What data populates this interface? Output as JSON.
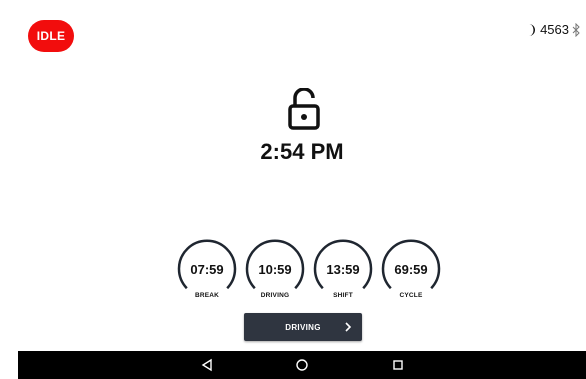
{
  "status": {
    "mode_badge": "IDLE",
    "unit_number": "4563",
    "icons": [
      "moon-icon",
      "bluetooth-icon"
    ]
  },
  "main": {
    "lock_icon": "unlocked-padlock-icon",
    "time": "2:54 PM"
  },
  "gauges": [
    {
      "value": "07:59",
      "label": "BREAK"
    },
    {
      "value": "10:59",
      "label": "DRIVING"
    },
    {
      "value": "13:59",
      "label": "SHIFT"
    },
    {
      "value": "69:59",
      "label": "CYCLE"
    }
  ],
  "action_button": {
    "label": "DRIVING",
    "icon": "chevron-right-icon"
  },
  "navigation_bar": {
    "icons": [
      "back-triangle-icon",
      "home-circle-icon",
      "recents-square-icon"
    ]
  },
  "colors": {
    "badge_red": "#f20d0d",
    "button_dark": "#2f3540",
    "nav_bar": "#000000",
    "gauge_ring": "#1f2630"
  }
}
